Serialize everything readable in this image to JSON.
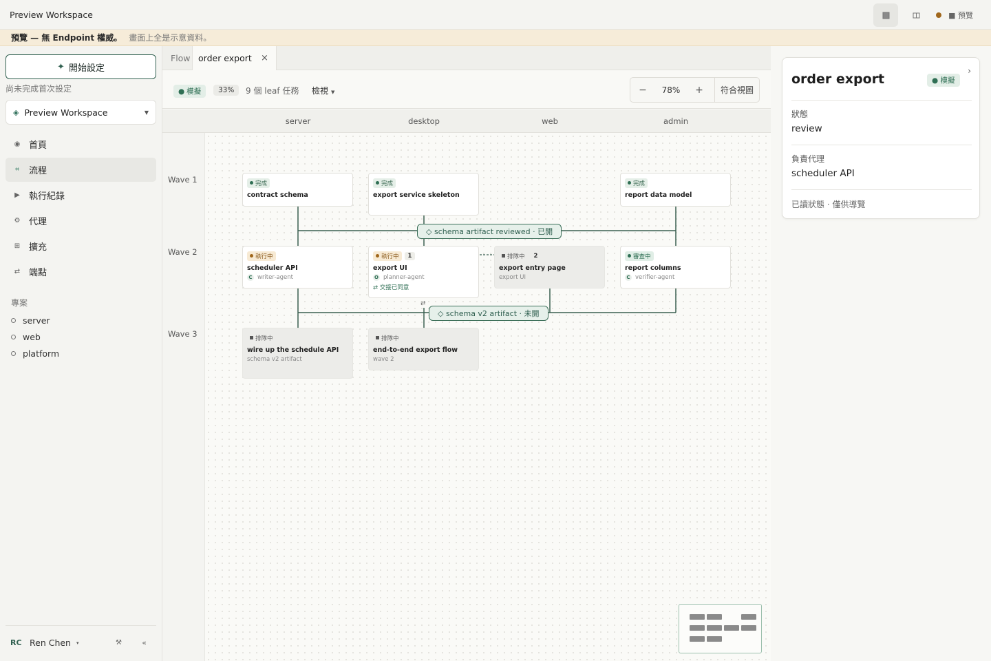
{
  "app": {
    "title": "Preview Workspace",
    "preview_label": "■ 預覽"
  },
  "banner": {
    "strong": "預覽 — 無 Endpoint 權威。",
    "soft": "畫面上全是示意資料。"
  },
  "sidebar": {
    "setup_button": "開始設定",
    "setup_note": "尚未完成首次設定",
    "workspace": "Preview Workspace",
    "nav": [
      {
        "label": "首頁",
        "icon": "home-icon"
      },
      {
        "label": "流程",
        "icon": "flow-icon",
        "active": true
      },
      {
        "label": "執行紀錄",
        "icon": "play-icon"
      },
      {
        "label": "代理",
        "icon": "agent-icon"
      },
      {
        "label": "擴充",
        "icon": "extension-icon"
      },
      {
        "label": "端點",
        "icon": "endpoint-icon"
      }
    ],
    "projects_heading": "專案",
    "projects": [
      "server",
      "web",
      "platform"
    ],
    "user": {
      "initials": "RC",
      "name": "Ren Chen"
    }
  },
  "tabs": {
    "flow": "Flow",
    "active": "order export",
    "close": "×"
  },
  "toolbar": {
    "mock_badge": "模擬",
    "progress": "33%",
    "leaf_count": "9 個 leaf 任務",
    "view_menu": "檢視",
    "zoom_out": "−",
    "zoom": "78%",
    "zoom_in": "+",
    "fit": "符合視圖"
  },
  "lanes": [
    "server",
    "desktop",
    "web",
    "admin"
  ],
  "waves": [
    "Wave 1",
    "Wave 2",
    "Wave 3"
  ],
  "nodes": [
    {
      "status": "完成",
      "title": "contract schema"
    },
    {
      "status": "完成",
      "title": "export service skeleton"
    },
    {
      "status": "完成",
      "title": "report data model"
    },
    {
      "status": "執行中",
      "title": "scheduler API",
      "agent_letter": "C",
      "agent": "writer-agent"
    },
    {
      "status": "執行中",
      "count": "1",
      "title": "export UI",
      "agent_letter": "O",
      "agent": "planner-agent",
      "handoff": "⇄ 交接已同意"
    },
    {
      "status": "排隊中",
      "count": "2",
      "title": "export entry page",
      "sub": "export UI"
    },
    {
      "status": "審查中",
      "title": "report columns",
      "agent_letter": "C",
      "agent": "verifier-agent"
    },
    {
      "status": "排隊中",
      "title": "wire up the schedule API",
      "sub": "schema v2 artifact"
    },
    {
      "status": "排隊中",
      "title": "end-to-end export flow",
      "sub": "wave 2"
    }
  ],
  "gates": [
    "◇ schema artifact reviewed · 已開",
    "◇ schema v2 artifact · 未開"
  ],
  "inspector": {
    "title": "order export",
    "badge": "模擬",
    "status_label": "狀態",
    "status_value": "review",
    "agent_label": "負責代理",
    "agent_value": "scheduler API",
    "footer": "已讀狀態 · 僅供導覽"
  },
  "colors": {
    "accent": "#2f5f4f",
    "edge": "#3b5f51",
    "running": "#a0671c",
    "banner_bg": "#f6ecd9"
  }
}
